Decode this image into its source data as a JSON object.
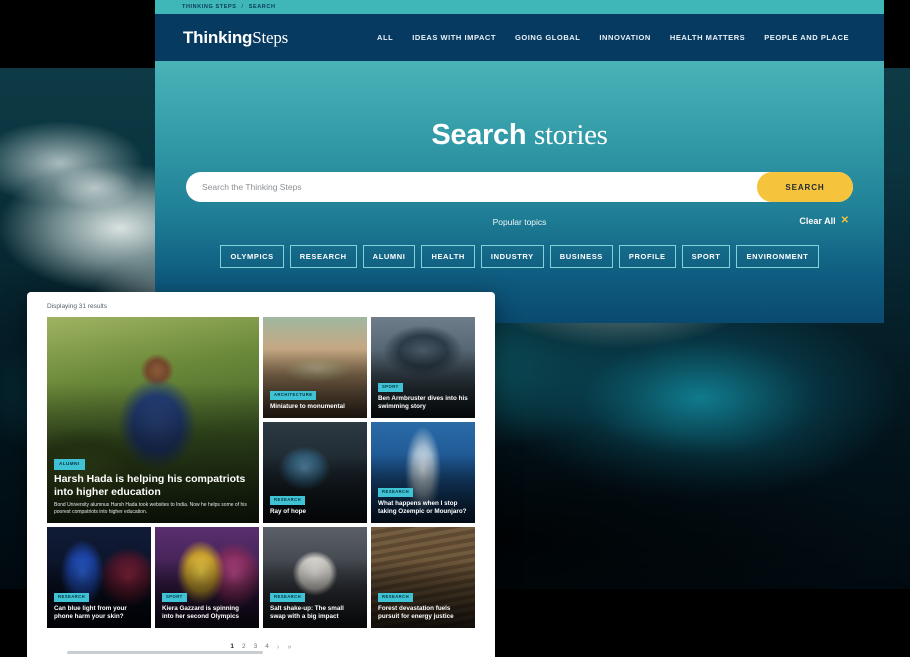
{
  "site": {
    "breadcrumb": {
      "root": "THINKING STEPS",
      "separator": "/",
      "current": "SEARCH"
    },
    "logo": {
      "bold": "Thinking",
      "light": "Steps"
    },
    "nav_items": [
      {
        "label": "ALL"
      },
      {
        "label": "IDEAS WITH IMPACT"
      },
      {
        "label": "GOING GLOBAL"
      },
      {
        "label": "INNOVATION"
      },
      {
        "label": "HEALTH MATTERS"
      },
      {
        "label": "PEOPLE AND PLACE"
      }
    ]
  },
  "hero": {
    "title_strong": "Search",
    "title_light": "stories",
    "search": {
      "placeholder": "Search the Thinking Steps",
      "value": "",
      "button_label": "SEARCH"
    },
    "topics_label": "Popular topics",
    "clear_all_label": "Clear All",
    "clear_all_icon": "close-icon",
    "chips": [
      {
        "label": "OLYMPICS"
      },
      {
        "label": "RESEARCH"
      },
      {
        "label": "ALUMNI"
      },
      {
        "label": "HEALTH"
      },
      {
        "label": "INDUSTRY"
      },
      {
        "label": "BUSINESS"
      },
      {
        "label": "PROFILE"
      },
      {
        "label": "SPORT"
      },
      {
        "label": "ENVIRONMENT"
      }
    ]
  },
  "results": {
    "count_text": "Displaying 31 results",
    "cards": [
      {
        "tags": [
          "ALUMNI"
        ],
        "title": "Harsh Hada is helping his compatriots into higher education",
        "description": "Bond University alumnus Harsh Hada took websites to India. Now he helps some of his poorest compatriots into higher education.",
        "art": "art-harsh",
        "feature": true
      },
      {
        "tags": [
          "ARCHITECTURE"
        ],
        "title": "Miniature to monumental",
        "description": "",
        "art": "art-arch",
        "feature": false
      },
      {
        "tags": [
          "SPORT"
        ],
        "title": "Ben Armbruster dives into his swimming story",
        "description": "",
        "art": "art-swim",
        "feature": false
      },
      {
        "tags": [
          "RESEARCH"
        ],
        "title": "Ray of hope",
        "description": "",
        "art": "art-ray",
        "feature": false
      },
      {
        "tags": [
          "RESEARCH"
        ],
        "title": "What happens when I stop taking Ozempic or Mounjaro?",
        "description": "",
        "art": "art-ozempic",
        "feature": false
      },
      {
        "tags": [
          "RESEARCH"
        ],
        "title": "Can blue light from your phone harm your skin?",
        "description": "",
        "art": "art-blue",
        "feature": false
      },
      {
        "tags": [
          "SPORT"
        ],
        "title": "Kiera Gazzard is spinning into her second Olympics",
        "description": "",
        "art": "art-kiera",
        "feature": false
      },
      {
        "tags": [
          "RESEARCH"
        ],
        "title": "Salt shake-up: The small swap with a big impact",
        "description": "",
        "art": "art-salt",
        "feature": false
      },
      {
        "tags": [
          "RESEARCH"
        ],
        "title": "Forest devastation fuels pursuit for energy justice",
        "description": "",
        "art": "art-forest",
        "feature": false
      }
    ],
    "pagination": {
      "pages": [
        "1",
        "2",
        "3",
        "4"
      ],
      "active": "1",
      "next_label": "›",
      "last_label": "»"
    }
  },
  "colors": {
    "nav_background": "#073a61",
    "breadcrumb_background": "#3fb6b8",
    "hero_top": "#4ab3b8",
    "hero_bottom": "#0a4a70",
    "accent_yellow": "#f5c33c",
    "tag_cyan": "#3fc3d4"
  }
}
